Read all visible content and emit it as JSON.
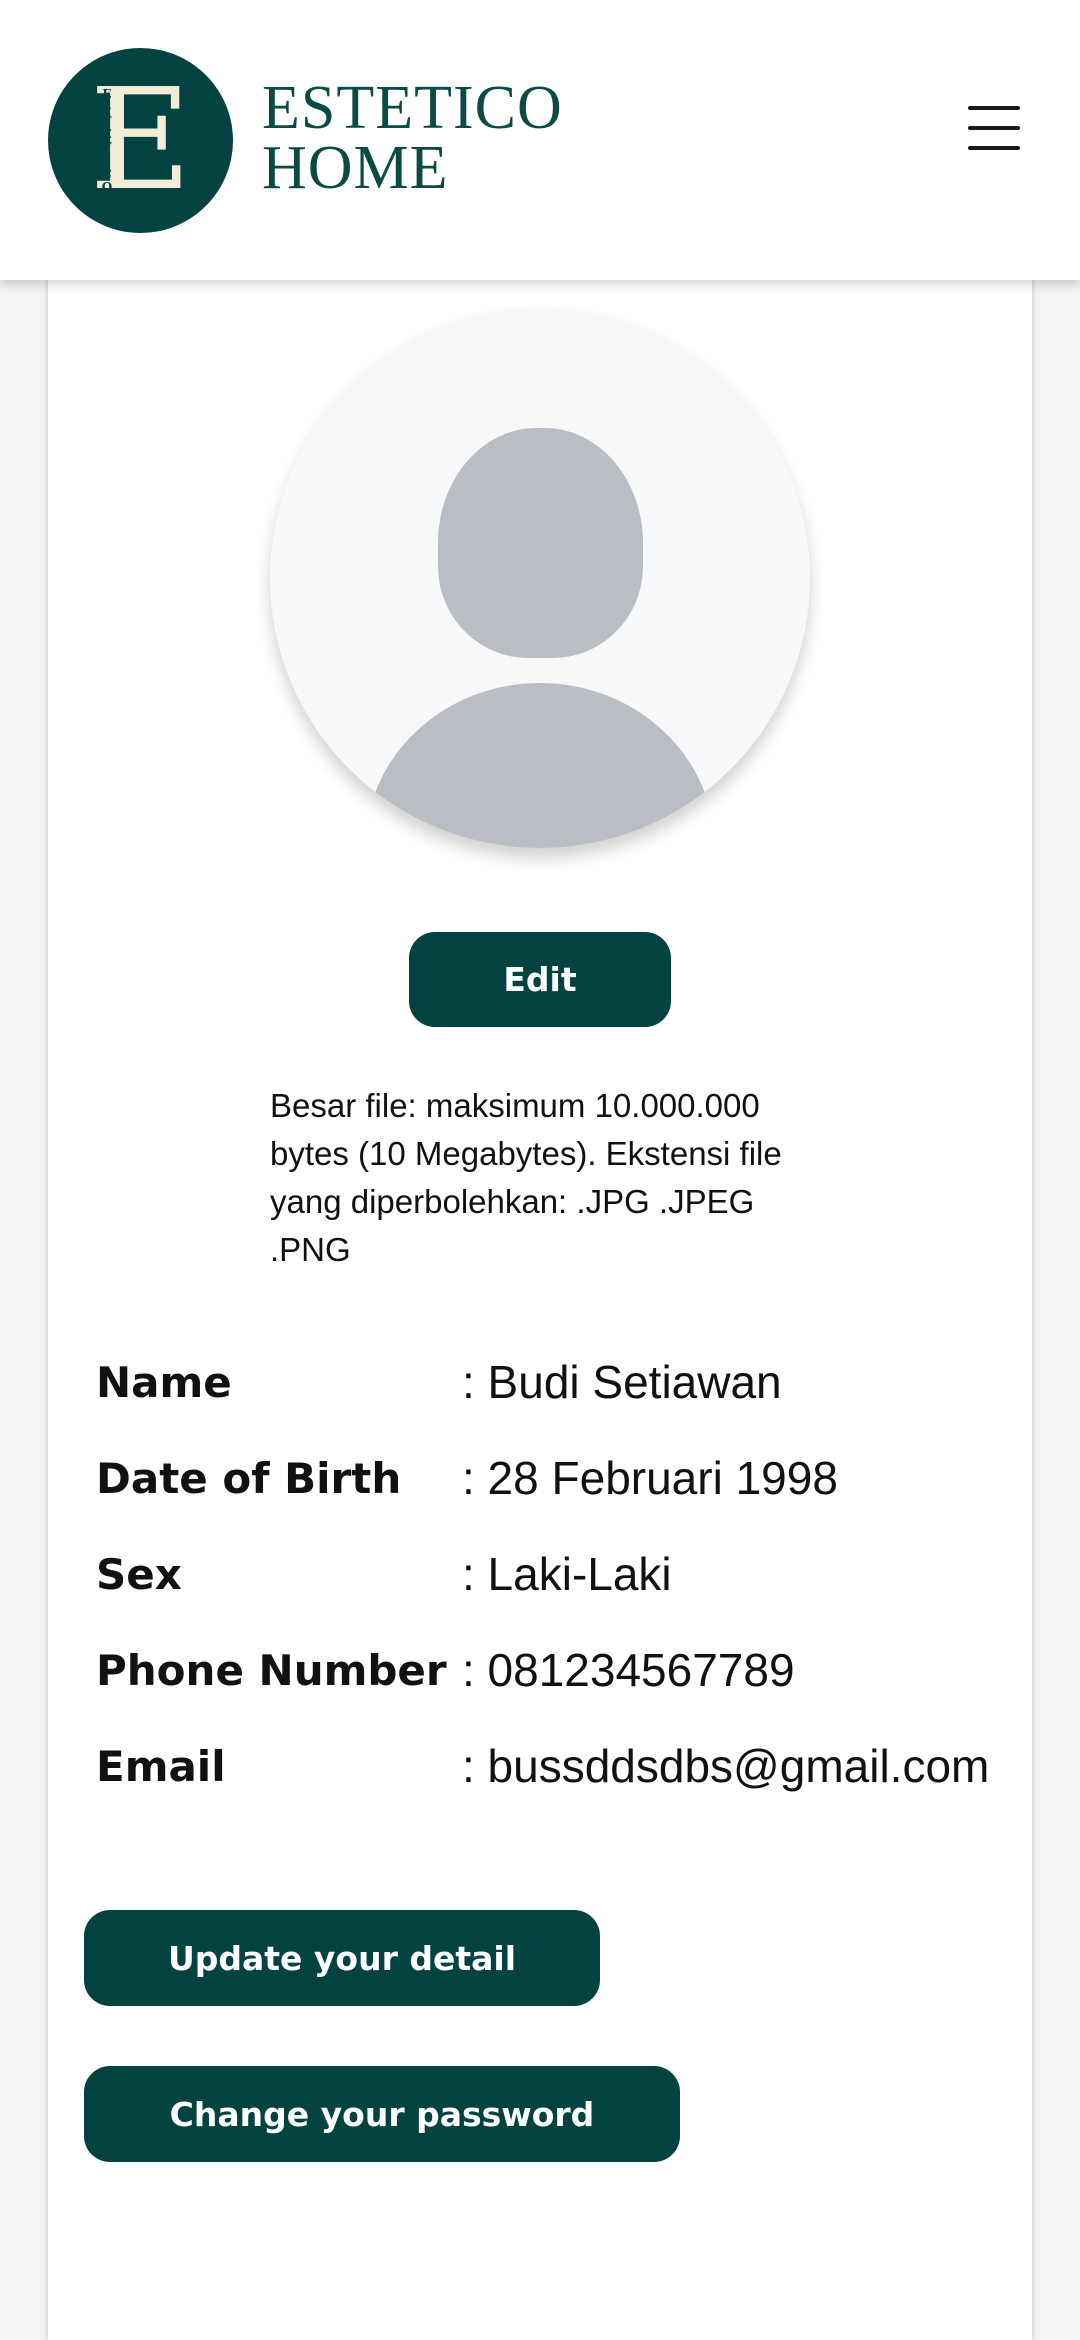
{
  "header": {
    "brand_line1": "ESTETICO",
    "brand_line2": "HOME",
    "logo_letter": "E",
    "logo_vertical_text": [
      "E",
      "S",
      "T",
      "E",
      "T",
      "I",
      "C",
      "O"
    ],
    "menu_icon": "hamburger-menu-icon"
  },
  "profile": {
    "avatar_icon": "default-avatar-icon",
    "edit_label": "Edit",
    "file_note": "Besar file: maksimum 10.000.000 bytes (10 Megabytes). Ekstensi file yang diperbolehkan: .JPG .JPEG .PNG"
  },
  "details": {
    "rows": [
      {
        "label": "Name",
        "value": ": Budi Setiawan"
      },
      {
        "label": "Date of Birth",
        "value": ": 28 Februari 1998"
      },
      {
        "label": "Sex",
        "value": ": Laki-Laki"
      },
      {
        "label": "Phone Number",
        "value": ": 081234567789"
      },
      {
        "label": "Email",
        "value": ": bussddsdbs@gmail.com"
      }
    ]
  },
  "actions": {
    "update_label": "Update your detail",
    "password_label": "Change your password"
  },
  "colors": {
    "brand": "#024240",
    "logo_cream": "#f3ecd6",
    "avatar_gray": "#b8bec3"
  }
}
